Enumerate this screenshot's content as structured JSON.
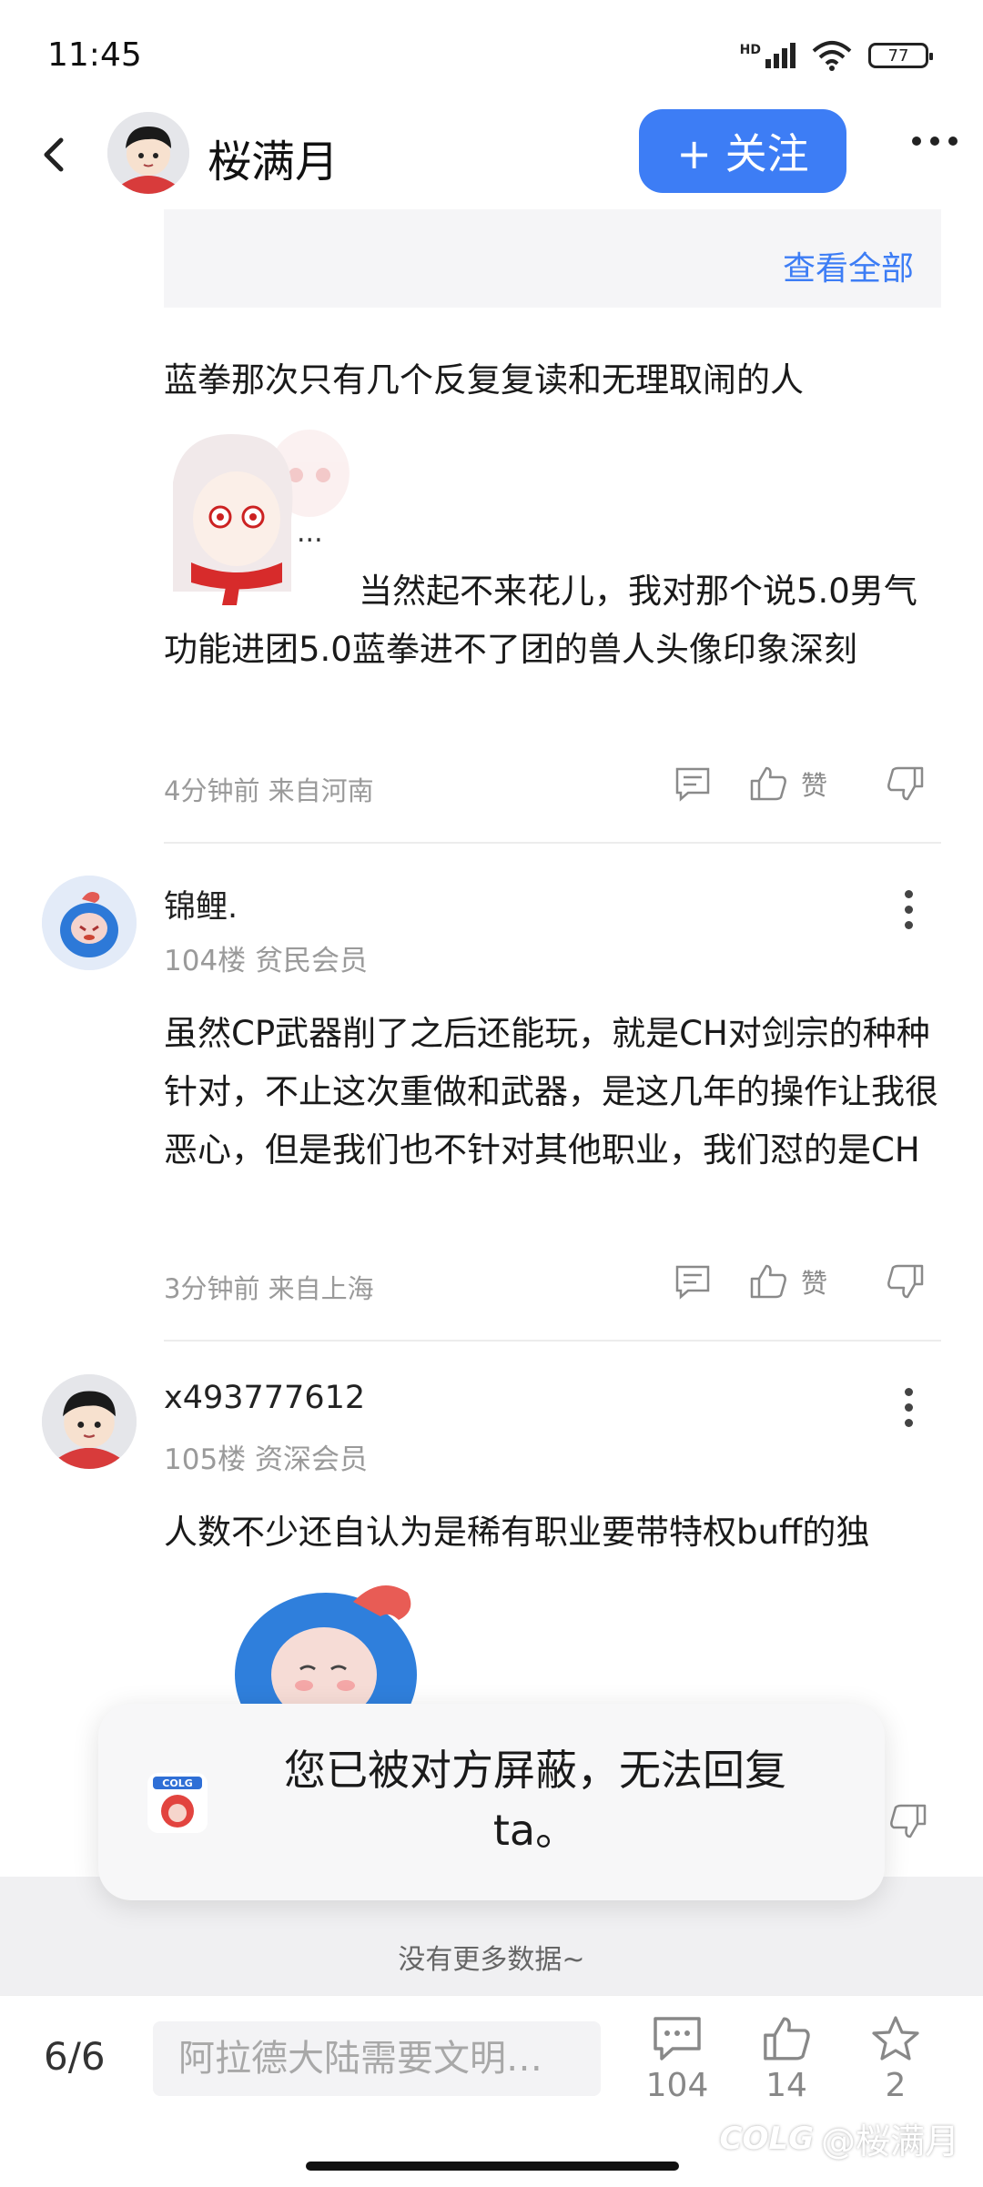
{
  "status": {
    "time": "11:45",
    "network": "HD",
    "battery": "77"
  },
  "header": {
    "title": "桜满月",
    "follow_label": "+ 关注"
  },
  "quote": {
    "view_all": "查看全部"
  },
  "comments": [
    {
      "text_line1": "蓝拳那次只有几个反复复读和无理取闹的人",
      "text_after_sticker": "当然起不来花儿，我对那个说5.0男气功能进团5.0蓝拳进不了团的兽人头像印象深刻",
      "sticker_text": "...",
      "meta": "4分钟前 来自河南",
      "like_label": "赞"
    },
    {
      "user": "锦鲤.",
      "floor": "104楼 贫民会员",
      "text": "虽然CP武器削了之后还能玩，就是CH对剑宗的种种针对，不止这次重做和武器，是这几年的操作让我很恶心，但是我们也不针对其他职业，我们怼的是CH",
      "meta": "3分钟前 来自上海",
      "like_label": "赞"
    },
    {
      "user": "x493777612",
      "floor": "105楼 资深会员",
      "text": "人数不少还自认为是稀有职业要带特权buff的独"
    }
  ],
  "toast": {
    "text": "您已被对方屏蔽，无法回复ta。",
    "app_icon": "colg-app-icon"
  },
  "footer": {
    "no_more": "没有更多数据~"
  },
  "bottom": {
    "pager": "6/6",
    "input_placeholder": "阿拉德大陆需要文明…",
    "comments_count": "104",
    "likes_count": "14",
    "favorites_count": "2"
  },
  "watermark": {
    "brand": "COLG",
    "handle": "@桜满月"
  },
  "colors": {
    "accent": "#3d7df5"
  }
}
